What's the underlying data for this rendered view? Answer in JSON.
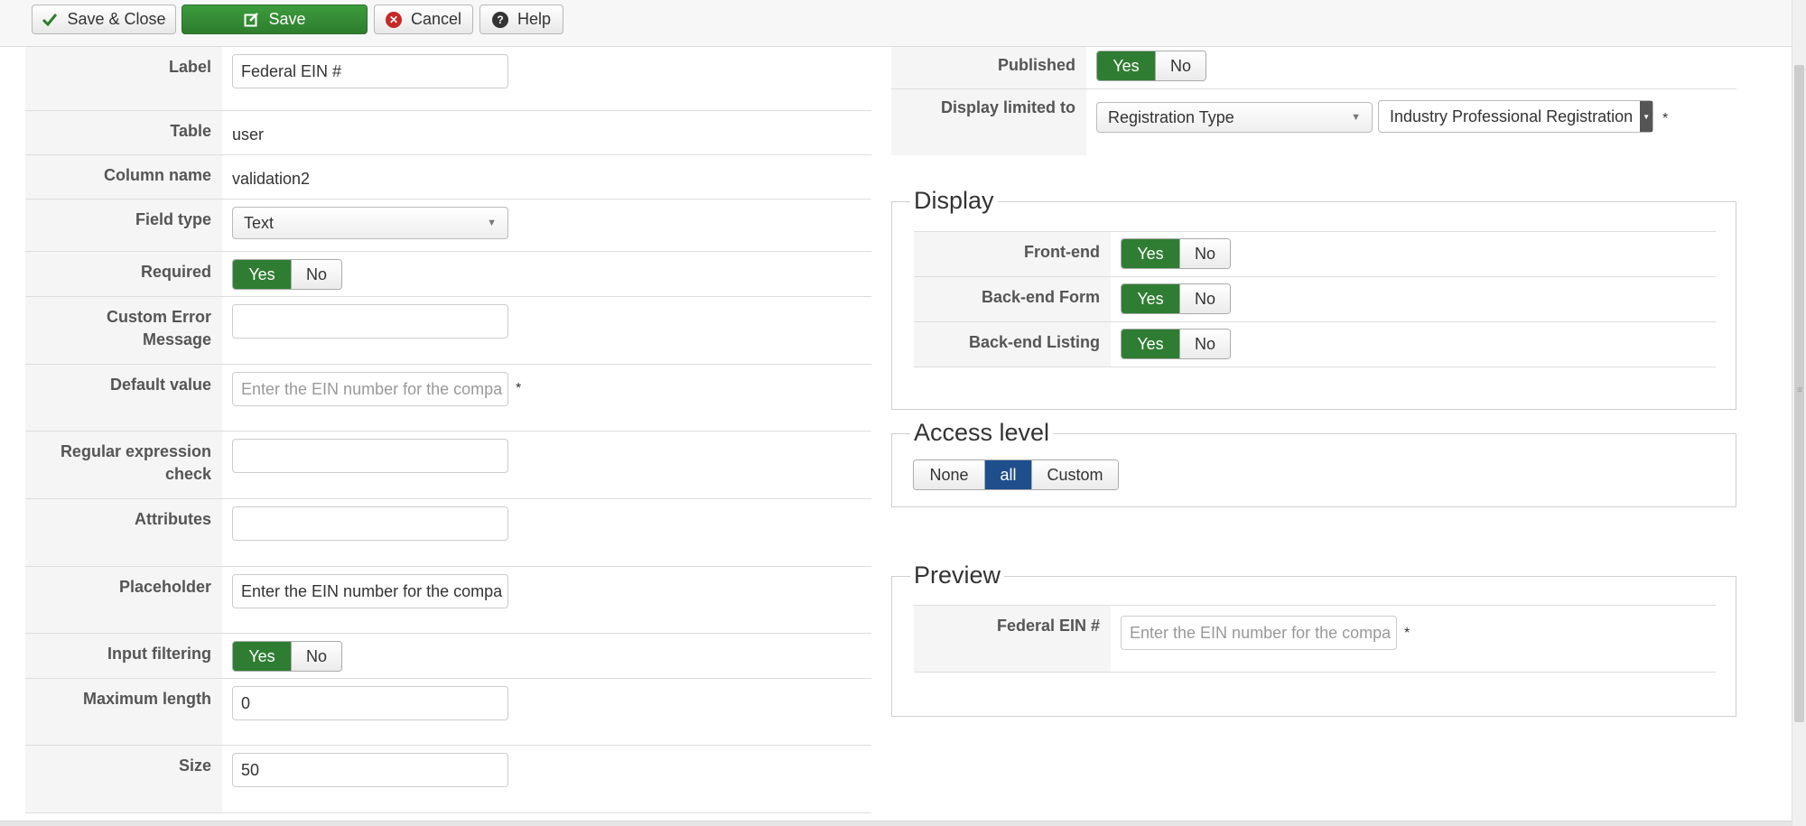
{
  "toolbar": {
    "save_close_label": "Save & Close",
    "save_label": "Save",
    "cancel_label": "Cancel",
    "help_label": "Help"
  },
  "left": {
    "label": {
      "label": "Label",
      "value": "Federal EIN #"
    },
    "table": {
      "label": "Table",
      "value": "user"
    },
    "column_name": {
      "label": "Column name",
      "value": "validation2"
    },
    "field_type": {
      "label": "Field type",
      "value": "Text"
    },
    "required": {
      "label": "Required",
      "yes": "Yes",
      "no": "No"
    },
    "custom_error": {
      "label_line1": "Custom Error",
      "label_line2": "Message",
      "value": ""
    },
    "default_value": {
      "label": "Default value",
      "placeholder": "Enter the EIN number for the compa",
      "required_mark": "*"
    },
    "regex": {
      "label_line1": "Regular expression",
      "label_line2": "check",
      "value": ""
    },
    "attributes": {
      "label": "Attributes",
      "value": ""
    },
    "placeholder": {
      "label": "Placeholder",
      "value": "Enter the EIN number for the compa"
    },
    "input_filtering": {
      "label": "Input filtering",
      "yes": "Yes",
      "no": "No"
    },
    "max_length": {
      "label": "Maximum length",
      "value": "0"
    },
    "size": {
      "label": "Size",
      "value": "50"
    }
  },
  "right": {
    "published": {
      "label": "Published",
      "yes": "Yes",
      "no": "No"
    },
    "display_limited": {
      "label": "Display limited to",
      "select1": "Registration Type",
      "select2": "Industry Professional Registration",
      "required_mark": "*"
    },
    "display": {
      "legend": "Display",
      "front_end": {
        "label": "Front-end",
        "yes": "Yes",
        "no": "No"
      },
      "backend_form": {
        "label": "Back-end Form",
        "yes": "Yes",
        "no": "No"
      },
      "backend_listing": {
        "label": "Back-end Listing",
        "yes": "Yes",
        "no": "No"
      }
    },
    "access": {
      "legend": "Access level",
      "none": "None",
      "all": "all",
      "custom": "Custom"
    },
    "preview": {
      "legend": "Preview",
      "field_label": "Federal EIN #",
      "placeholder": "Enter the EIN number for the compa",
      "required_mark": "*"
    }
  },
  "colors": {
    "green": "#2f7d32",
    "blue": "#1e4e8c",
    "cancel_red": "#c62828"
  }
}
